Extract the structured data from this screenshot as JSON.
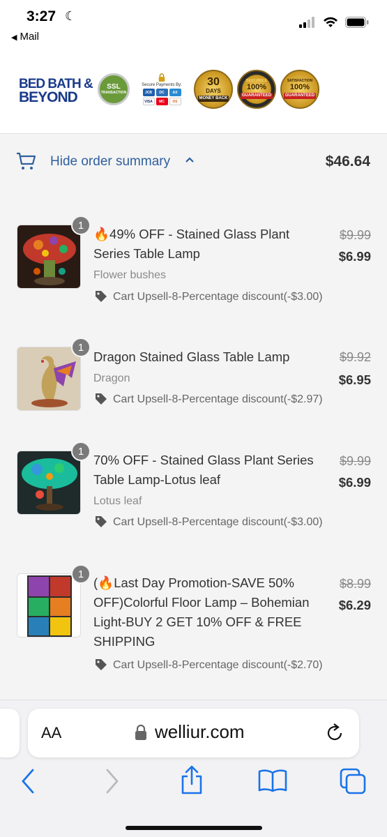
{
  "status": {
    "time": "3:27",
    "back_label": "Mail"
  },
  "header": {
    "logo_line1": "BED BATH &",
    "logo_line2": "BEYOND",
    "ssl_text": "SSL",
    "ssl_sub": "TRANSACTION",
    "secure_text": "Secure Payments By:",
    "badge_30": "30",
    "badge_30_sub": "DAYS",
    "badge_30_ribbon": "MONEY BACK",
    "badge_best": "100%",
    "badge_best_top": "BEST PRICE",
    "badge_best_ribbon": "GUARANTEED",
    "badge_sat": "100%",
    "badge_sat_top": "SATISFACTION",
    "badge_sat_ribbon": "GUARANTEED"
  },
  "summary": {
    "toggle_label": "Hide order summary",
    "total": "$46.64"
  },
  "items": [
    {
      "qty": "1",
      "title": "🔥49% OFF - Stained Glass Plant Series Table Lamp",
      "variant": "Flower bushes",
      "discount": "Cart Upsell-8-Percentage discount(-$3.00)",
      "price_old": "$9.99",
      "price_new": "$6.99",
      "thumb_icon": "mushroom-lamp-image"
    },
    {
      "qty": "1",
      "title": "Dragon Stained Glass Table Lamp",
      "variant": "Dragon",
      "discount": "Cart Upsell-8-Percentage discount(-$2.97)",
      "price_old": "$9.92",
      "price_new": "$6.95",
      "thumb_icon": "dragon-lamp-image"
    },
    {
      "qty": "1",
      "title": "70% OFF - Stained Glass Plant Series Table Lamp-Lotus leaf",
      "variant": "Lotus leaf",
      "discount": "Cart Upsell-8-Percentage discount(-$3.00)",
      "price_old": "$9.99",
      "price_new": "$6.99",
      "thumb_icon": "lotus-lamp-image"
    },
    {
      "qty": "1",
      "title": "(🔥Last Day Promotion-SAVE 50% OFF)Colorful Floor Lamp – Bohemian Light-BUY 2 GET 10% OFF & FREE SHIPPING",
      "variant": "",
      "discount": "Cart Upsell-8-Percentage discount(-$2.70)",
      "price_old": "$8.99",
      "price_new": "$6.29",
      "thumb_icon": "floor-lamp-collage-image"
    }
  ],
  "browser": {
    "aa_label": "AA",
    "url": "welliur.com"
  },
  "colors": {
    "link": "#2f5f9d",
    "ios_blue": "#1a73e8",
    "logo_blue": "#1a3a8a"
  }
}
